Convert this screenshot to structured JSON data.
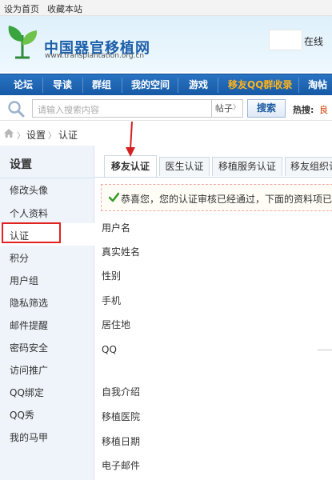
{
  "topbar": {
    "set_home": "设为首页",
    "bookmark": "收藏本站"
  },
  "header": {
    "logo_text": "中国器官移植网",
    "logo_url": "www.transplantation.org.cn",
    "online_label": "在线"
  },
  "nav": {
    "items": [
      "论坛",
      "导读",
      "群组",
      "我的空间",
      "游戏",
      "移友QQ群收录",
      "淘帖"
    ],
    "highlight_color": "#ffb31a"
  },
  "search": {
    "placeholder": "请输入搜索内容",
    "type": "帖子",
    "button": "搜索",
    "hot_label": "热搜:",
    "hot_item": "良"
  },
  "breadcrumb": [
    "设置",
    "认证"
  ],
  "sidebar": {
    "title": "设置",
    "items": [
      "修改头像",
      "个人资料",
      "认证",
      "积分",
      "用户组",
      "隐私筛选",
      "邮件提醒",
      "密码安全",
      "访问推广",
      "QQ绑定",
      "QQ秀",
      "我的马甲"
    ],
    "active_index": 2
  },
  "tabs": [
    "移友认证",
    "医生认证",
    "移植服务认证",
    "移友组织认"
  ],
  "notice": "恭喜您，您的认证审核已经通过，下面的资料项已经",
  "fields": [
    "用户名",
    "真实姓名",
    "性别",
    "手机",
    "居住地",
    "QQ",
    "自我介绍",
    "移植医院",
    "移植日期",
    "电子邮件"
  ],
  "colors": {
    "nav_bg": "#1e66b5",
    "annotation_red": "#e0211d",
    "sidebar_bg": "#eef4fa"
  }
}
